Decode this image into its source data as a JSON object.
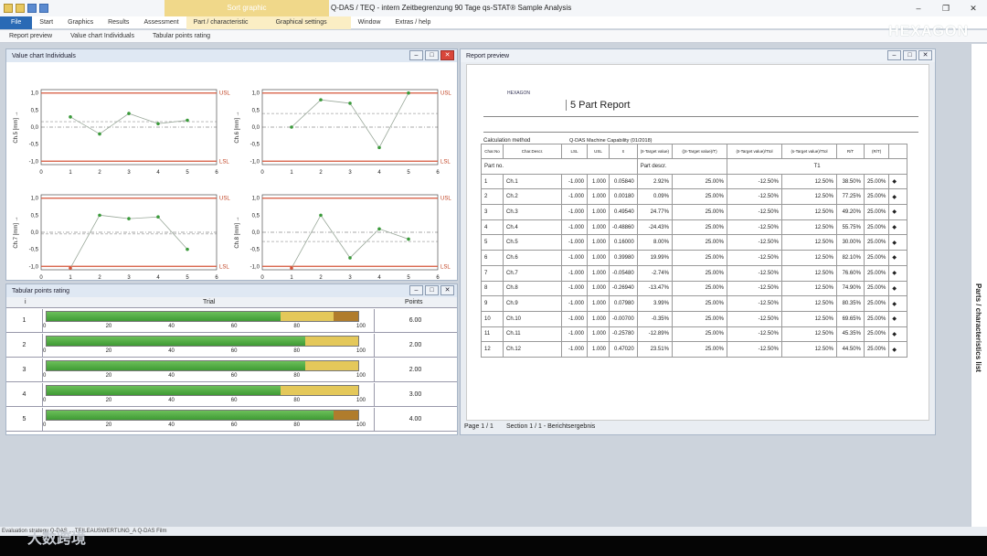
{
  "titlebar": {
    "context_tab": "Sort graphic",
    "title": "Q-DAS / TEQ - intern Zeitbegrenzung 90 Tage      qs-STAT® Sample Analysis"
  },
  "menu": {
    "items": [
      "File",
      "Start",
      "Graphics",
      "Results",
      "Assessment",
      "Part / characteristic",
      "Graphical settings",
      "Window",
      "Extras / help"
    ]
  },
  "toolbar": {
    "items": [
      "Report preview",
      "Value chart Individuals",
      "Tabular points rating"
    ]
  },
  "brand": "HEXAGON",
  "value_chart": {
    "title": "Value chart Individuals",
    "usl": "USL",
    "lsl": "LSL",
    "yticks": [
      "1,0",
      "0,5",
      "0,0",
      "-0,5",
      "-1,0"
    ],
    "xticks": [
      "0",
      "1",
      "2",
      "3",
      "4",
      "5",
      "6"
    ],
    "charts": [
      {
        "ylabel": "Ch.5 [mm] →",
        "values": [
          0.3,
          -0.2,
          0.4,
          0.1,
          0.2
        ],
        "mean": 0.16
      },
      {
        "ylabel": "Ch.6 [mm] →",
        "values": [
          0.0,
          0.8,
          0.7,
          -0.6,
          1.0
        ],
        "mean": 0.4
      },
      {
        "ylabel": "Ch.7 [mm] →",
        "values": [
          -1.05,
          0.5,
          0.4,
          0.45,
          -0.5
        ],
        "mean": -0.05
      },
      {
        "ylabel": "Ch.8 [mm] →",
        "values": [
          -1.05,
          0.5,
          -0.75,
          0.1,
          -0.2
        ],
        "mean": -0.27
      }
    ]
  },
  "points_rating": {
    "title": "Tabular points rating",
    "col_i": "i",
    "col_trial": "Trial",
    "col_points": "Points",
    "ticks": [
      "0",
      "20",
      "40",
      "60",
      "80",
      "100"
    ],
    "rows": [
      {
        "i": "1",
        "green": 75,
        "yellow": 17,
        "brown": 8,
        "points": "6.00"
      },
      {
        "i": "2",
        "green": 83,
        "yellow": 17,
        "brown": 0,
        "points": "2.00"
      },
      {
        "i": "3",
        "green": 83,
        "yellow": 17,
        "brown": 0,
        "points": "2.00"
      },
      {
        "i": "4",
        "green": 75,
        "yellow": 25,
        "brown": 0,
        "points": "3.00"
      },
      {
        "i": "5",
        "green": 92,
        "yellow": 0,
        "brown": 8,
        "points": "4.00"
      }
    ]
  },
  "report": {
    "title": "Report preview",
    "heading": "5 Part Report",
    "logo": "HEXAGON",
    "calc_label": "Calculation method",
    "calc_value": "Q-DAS Machine Capability (01/2018)",
    "col_headers": [
      "Char.No",
      "Char.Descr.",
      "LSL",
      "USL",
      "x̄",
      "(x̄-Target value)",
      "((x̄-Target value)/T)",
      "(x̄-Target value)/Ttol",
      "(s-Target value)/Ttol",
      "(s-Target value)/Ttol",
      "R/T",
      "(R/T)"
    ],
    "part_no": "Part no.",
    "part_descr": "Part descr.",
    "part_val": "T1",
    "rows": [
      [
        "1",
        "Ch.1",
        "-1.000",
        "1.000",
        "0.05840",
        "2.92%",
        "25.00%",
        "-12.50%",
        "12.50%",
        "38.50%",
        "25.00%"
      ],
      [
        "2",
        "Ch.2",
        "-1.000",
        "1.000",
        "0.00180",
        "0.09%",
        "25.00%",
        "-12.50%",
        "12.50%",
        "77.25%",
        "25.00%"
      ],
      [
        "3",
        "Ch.3",
        "-1.000",
        "1.000",
        "0.49540",
        "24.77%",
        "25.00%",
        "-12.50%",
        "12.50%",
        "49.20%",
        "25.00%"
      ],
      [
        "4",
        "Ch.4",
        "-1.000",
        "1.000",
        "-0.48860",
        "-24.43%",
        "25.00%",
        "-12.50%",
        "12.50%",
        "55.75%",
        "25.00%"
      ],
      [
        "5",
        "Ch.5",
        "-1.000",
        "1.000",
        "0.16000",
        "8.00%",
        "25.00%",
        "-12.50%",
        "12.50%",
        "30.00%",
        "25.00%"
      ],
      [
        "6",
        "Ch.6",
        "-1.000",
        "1.000",
        "0.39980",
        "19.99%",
        "25.00%",
        "-12.50%",
        "12.50%",
        "82.10%",
        "25.00%"
      ],
      [
        "7",
        "Ch.7",
        "-1.000",
        "1.000",
        "-0.05480",
        "-2.74%",
        "25.00%",
        "-12.50%",
        "12.50%",
        "76.60%",
        "25.00%"
      ],
      [
        "8",
        "Ch.8",
        "-1.000",
        "1.000",
        "-0.26940",
        "-13.47%",
        "25.00%",
        "-12.50%",
        "12.50%",
        "74.90%",
        "25.00%"
      ],
      [
        "9",
        "Ch.9",
        "-1.000",
        "1.000",
        "0.07980",
        "3.99%",
        "25.00%",
        "-12.50%",
        "12.50%",
        "80.35%",
        "25.00%"
      ],
      [
        "10",
        "Ch.10",
        "-1.000",
        "1.000",
        "-0.00700",
        "-0.35%",
        "25.00%",
        "-12.50%",
        "12.50%",
        "69.65%",
        "25.00%"
      ],
      [
        "11",
        "Ch.11",
        "-1.000",
        "1.000",
        "-0.25780",
        "-12.89%",
        "25.00%",
        "-12.50%",
        "12.50%",
        "45.35%",
        "25.00%"
      ],
      [
        "12",
        "Ch.12",
        "-1.000",
        "1.000",
        "0.47020",
        "23.51%",
        "25.00%",
        "-12.50%",
        "12.50%",
        "44.50%",
        "25.00%"
      ]
    ],
    "footer_page": "Page 1 / 1",
    "footer_section": "Section 1 / 1 - Berichtsergebnis"
  },
  "side_tab": "Parts / characteristics list",
  "status": "Evaluation strategy   Q-DAS ...   TEILEAUSWERTUNG_A   Q-DAS Film",
  "watermark": "大数跨境"
}
